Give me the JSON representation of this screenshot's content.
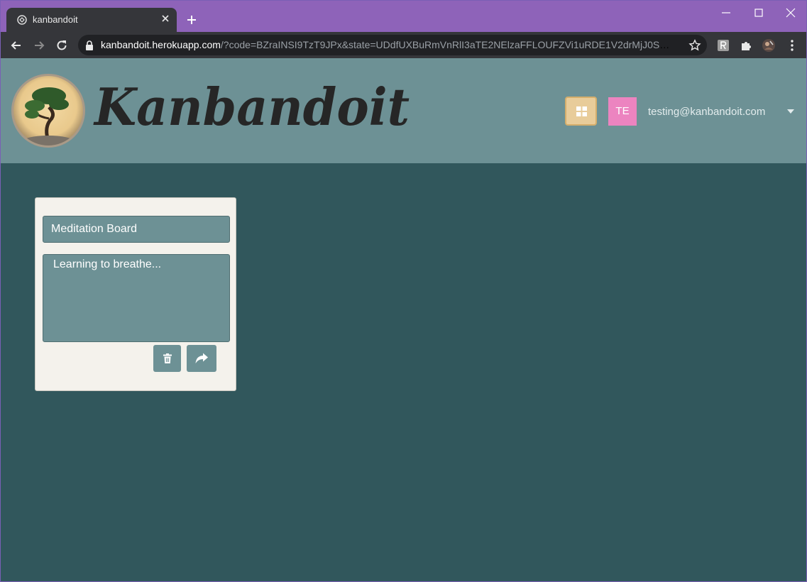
{
  "browser": {
    "tab_title": "kanbandoit",
    "url_host": "kanbandoit.herokuapp.com",
    "url_path": "/?code=BZraINSI9TzT9JPx&state=UDdfUXBuRmVnRlI3aTE2NElzaFFLOUFZVi1uRDE1V2drMjJ0SGNtWm...",
    "icons": [
      "favicon-icon",
      "tab-close-icon",
      "new-tab-icon",
      "minimize-icon",
      "maximize-icon",
      "window-close-icon",
      "back-icon",
      "forward-icon",
      "reload-icon",
      "lock-icon",
      "bookmark-star-icon",
      "extension-r-icon",
      "extensions-puzzle-icon",
      "profile-icon",
      "menu-dots-icon"
    ]
  },
  "app": {
    "brand": "Kanbandoit",
    "brand_color": "#6d9195",
    "background_color": "#31575c",
    "avatar_initials": "TE",
    "avatar_color": "#ec84c0",
    "user_email": "testing@kanbandoit.com"
  },
  "board": {
    "title": "Meditation Board",
    "description": "Learning to breathe...",
    "actions": [
      "trash-icon",
      "share-arrow-icon"
    ]
  }
}
